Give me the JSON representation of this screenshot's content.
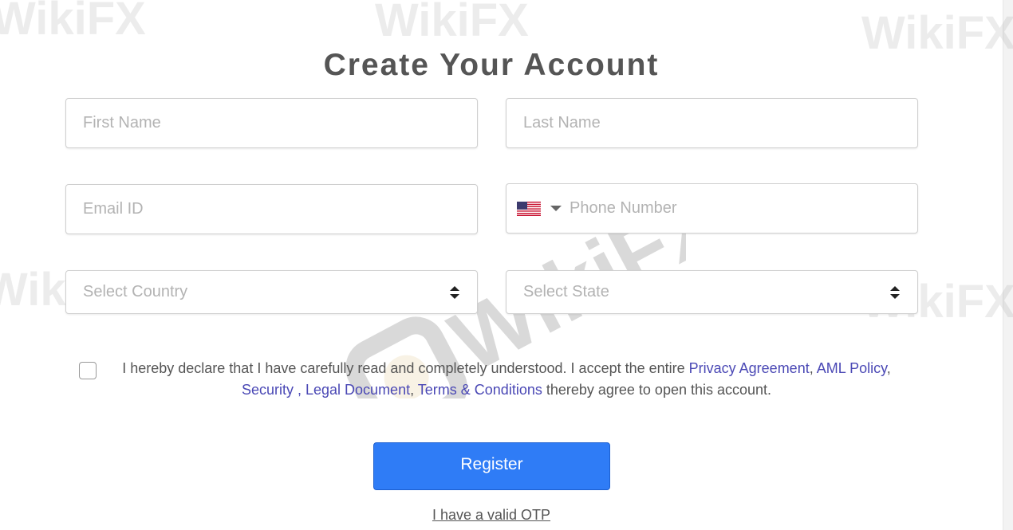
{
  "header": {
    "title": "Create Your Account"
  },
  "form": {
    "first_name_placeholder": "First Name",
    "last_name_placeholder": "Last Name",
    "email_placeholder": "Email ID",
    "phone_placeholder": "Phone Number",
    "country_placeholder": "Select Country",
    "state_placeholder": "Select State",
    "phone_country_icon": "us-flag-icon"
  },
  "declaration": {
    "text_1": "I hereby declare that I have carefully read and completely understood. I accept the entire ",
    "link_privacy": "Privacy Agreement",
    "sep_1": ", ",
    "link_aml": "AML Policy",
    "sep_2": ", ",
    "link_security": "Security ,",
    "sep_3": " ",
    "link_legal": "Legal Document",
    "sep_4": ", ",
    "link_terms": "Terms & Conditions",
    "text_2": " thereby agree to open this account."
  },
  "actions": {
    "register_label": "Register",
    "otp_link": "I have a valid OTP"
  },
  "watermark": {
    "text": "WikiFX"
  },
  "colors": {
    "accent": "#2f7cf6",
    "link": "#4a48b5",
    "title": "#555555",
    "placeholder": "#b3b3b3"
  }
}
